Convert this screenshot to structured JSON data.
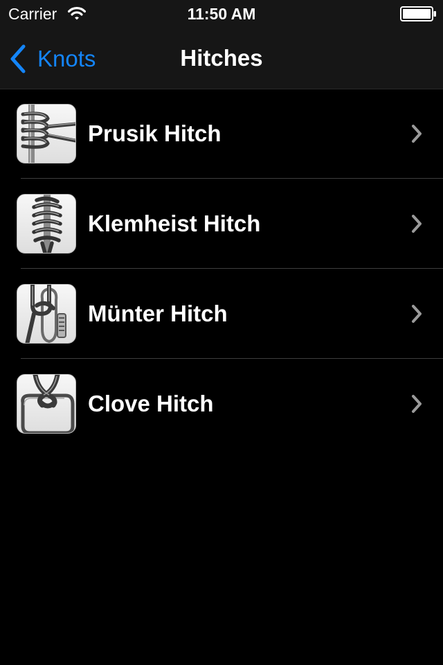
{
  "status_bar": {
    "carrier": "Carrier",
    "time": "11:50 AM",
    "wifi_icon": "wifi-icon",
    "battery_icon": "battery-full-icon"
  },
  "nav": {
    "back_label": "Knots",
    "back_icon": "chevron-left-icon",
    "title": "Hitches",
    "accent_color": "#1485fa"
  },
  "items": [
    {
      "title": "Prusik Hitch",
      "thumbnail_icon": "prusik-hitch-thumbnail",
      "accessory_icon": "chevron-right-icon"
    },
    {
      "title": "Klemheist Hitch",
      "thumbnail_icon": "klemheist-hitch-thumbnail",
      "accessory_icon": "chevron-right-icon"
    },
    {
      "title": "Münter Hitch",
      "thumbnail_icon": "munter-hitch-thumbnail",
      "accessory_icon": "chevron-right-icon"
    },
    {
      "title": "Clove Hitch",
      "thumbnail_icon": "clove-hitch-thumbnail",
      "accessory_icon": "chevron-right-icon"
    }
  ]
}
